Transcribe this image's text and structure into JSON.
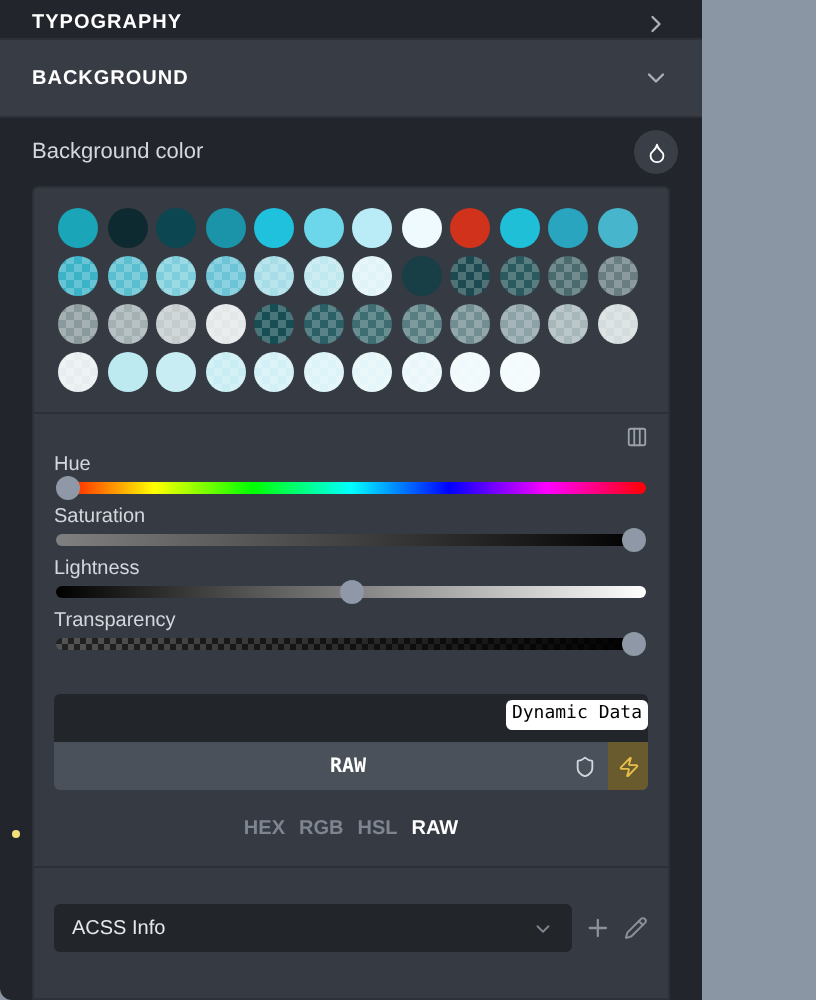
{
  "sections": [
    {
      "title": "TYPOGRAPHY",
      "expanded": false
    },
    {
      "title": "BACKGROUND",
      "expanded": true
    }
  ],
  "field_label": "Background color",
  "palette": [
    {
      "kind": "solid",
      "color": "#1ba5b8"
    },
    {
      "kind": "solid",
      "color": "#0c2a30"
    },
    {
      "kind": "solid",
      "color": "#0c4650"
    },
    {
      "kind": "solid",
      "color": "#1b93a8"
    },
    {
      "kind": "solid",
      "color": "#1fc1dc"
    },
    {
      "kind": "solid",
      "color": "#6cd6ea"
    },
    {
      "kind": "solid",
      "color": "#b9ecf6"
    },
    {
      "kind": "solid",
      "color": "#eefafd"
    },
    {
      "kind": "solid",
      "color": "#d0321c"
    },
    {
      "kind": "solid",
      "color": "#1fbfd8"
    },
    {
      "kind": "solid",
      "color": "#2aa5c0"
    },
    {
      "kind": "solid",
      "color": "#47b5cc"
    },
    {
      "kind": "translucent",
      "color": "#3bb4c8"
    },
    {
      "kind": "translucent",
      "color": "#5bbfd0"
    },
    {
      "kind": "translucent",
      "color": "#7fcedb"
    },
    {
      "kind": "translucent",
      "color": "#6cc4d6"
    },
    {
      "kind": "translucent",
      "color": "#a6dde6"
    },
    {
      "kind": "translucent",
      "color": "#bfe8ef"
    },
    {
      "kind": "translucent",
      "color": "#e0f4f7"
    },
    {
      "kind": "solid",
      "color": "#173f45"
    },
    {
      "kind": "translucent",
      "color": "#1d4a50"
    },
    {
      "kind": "translucent",
      "color": "#2a5a5e"
    },
    {
      "kind": "translucent",
      "color": "#4a6a6e"
    },
    {
      "kind": "translucent",
      "color": "#6a7e82"
    },
    {
      "kind": "translucent",
      "color": "#8a9a9c"
    },
    {
      "kind": "translucent",
      "color": "#a4b0b2"
    },
    {
      "kind": "translucent",
      "color": "#c4cccd"
    },
    {
      "kind": "translucent",
      "color": "#e4e8e9"
    },
    {
      "kind": "translucent",
      "color": "#164e54"
    },
    {
      "kind": "translucent",
      "color": "#2a6066"
    },
    {
      "kind": "translucent",
      "color": "#3e6e72"
    },
    {
      "kind": "translucent",
      "color": "#587e82"
    },
    {
      "kind": "translucent",
      "color": "#728e92"
    },
    {
      "kind": "translucent",
      "color": "#8ca2a6"
    },
    {
      "kind": "translucent",
      "color": "#a8b8ba"
    },
    {
      "kind": "translucent",
      "color": "#d4dcdd"
    },
    {
      "kind": "translucent",
      "color": "#e8eeef"
    },
    {
      "kind": "solid",
      "color": "#bde9f1"
    },
    {
      "kind": "solid",
      "color": "#c8eef4"
    },
    {
      "kind": "translucent",
      "color": "#c8eef4"
    },
    {
      "kind": "translucent",
      "color": "#d2f0f5"
    },
    {
      "kind": "translucent",
      "color": "#dcf3f7"
    },
    {
      "kind": "translucent",
      "color": "#e4f6f9"
    },
    {
      "kind": "translucent",
      "color": "#eaf7fa"
    },
    {
      "kind": "translucent",
      "color": "#f0f9fb"
    },
    {
      "kind": "translucent",
      "color": "#f4fbfc"
    }
  ],
  "sliders": [
    {
      "kind": "hue",
      "label": "Hue",
      "level": 0
    },
    {
      "kind": "saturation",
      "label": "Saturation",
      "level": 1
    },
    {
      "kind": "lightness",
      "label": "Lightness",
      "level": 0.5
    },
    {
      "kind": "transparency",
      "label": "Transparency",
      "level": 1
    }
  ],
  "tooltip": "Dynamic Data",
  "value_display": "RAW",
  "dynamic_data_active": true,
  "formats": [
    {
      "label": "HEX",
      "selected": false
    },
    {
      "label": "RGB",
      "selected": false
    },
    {
      "label": "HSL",
      "selected": false
    },
    {
      "label": "RAW",
      "selected": true
    }
  ],
  "preset_select": {
    "value": "ACSS Info"
  }
}
